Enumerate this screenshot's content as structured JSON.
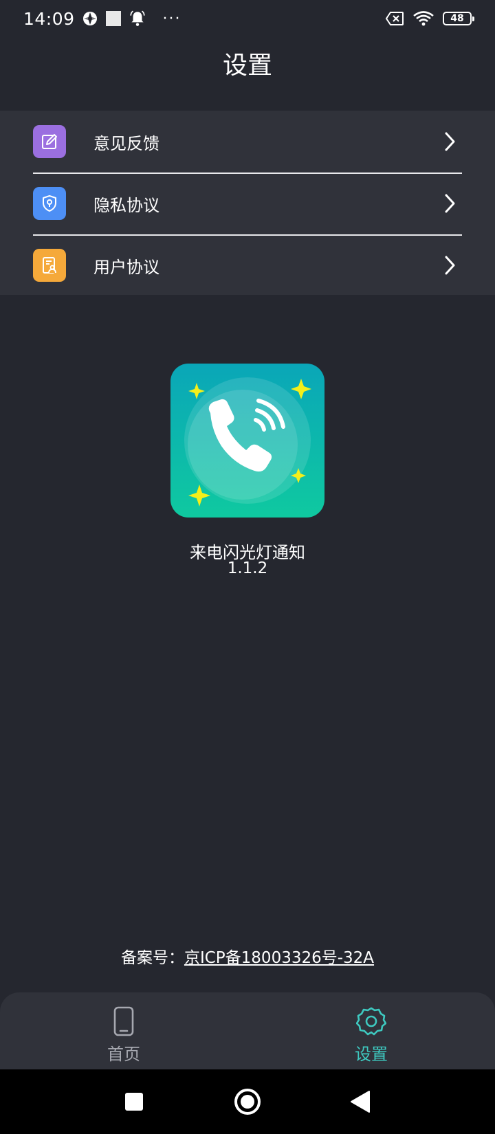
{
  "status_bar": {
    "time": "14:09",
    "battery": "48",
    "more": "···"
  },
  "header": {
    "title": "设置"
  },
  "menu": {
    "items": [
      {
        "label": "意见反馈",
        "icon": "edit-icon",
        "color": "#9b6fe0"
      },
      {
        "label": "隐私协议",
        "icon": "shield-icon",
        "color": "#4d8ff5"
      },
      {
        "label": "用户协议",
        "icon": "document-user-icon",
        "color": "#f5a93a"
      }
    ]
  },
  "app_info": {
    "name": "来电闪光灯通知",
    "version": "1.1.2"
  },
  "icp": {
    "prefix": "备案号：",
    "number": "京ICP备18003326号-32A"
  },
  "tabbar": {
    "tabs": [
      {
        "label": "首页",
        "icon": "phone-icon",
        "active": false
      },
      {
        "label": "设置",
        "icon": "gear-icon",
        "active": true
      }
    ],
    "active_color": "#3ec9c0",
    "inactive_color": "#a6a8b0"
  },
  "navbar": {
    "buttons": [
      "recents-icon",
      "home-icon",
      "back-icon"
    ]
  }
}
